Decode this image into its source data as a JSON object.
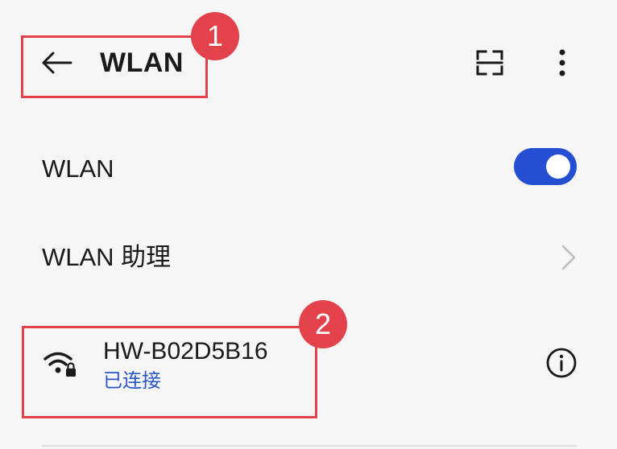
{
  "header": {
    "title": "WLAN",
    "back_icon": "arrow-left-icon",
    "scan_icon": "scan-frame-icon",
    "more_icon": "more-vertical-icon"
  },
  "settings": {
    "wlan_label": "WLAN",
    "wlan_enabled": true,
    "assistant_label": "WLAN 助理"
  },
  "network": {
    "ssid": "HW-B02D5B16",
    "status": "已连接",
    "secured": true,
    "icon": "wifi-lock-icon",
    "info_icon": "info-icon"
  },
  "annotations": {
    "badge_1": "1",
    "badge_2": "2"
  },
  "colors": {
    "accent": "#254fd3",
    "status_text": "#2c56c8",
    "annotation": "#e3424b",
    "background": "#f6f6f6"
  }
}
